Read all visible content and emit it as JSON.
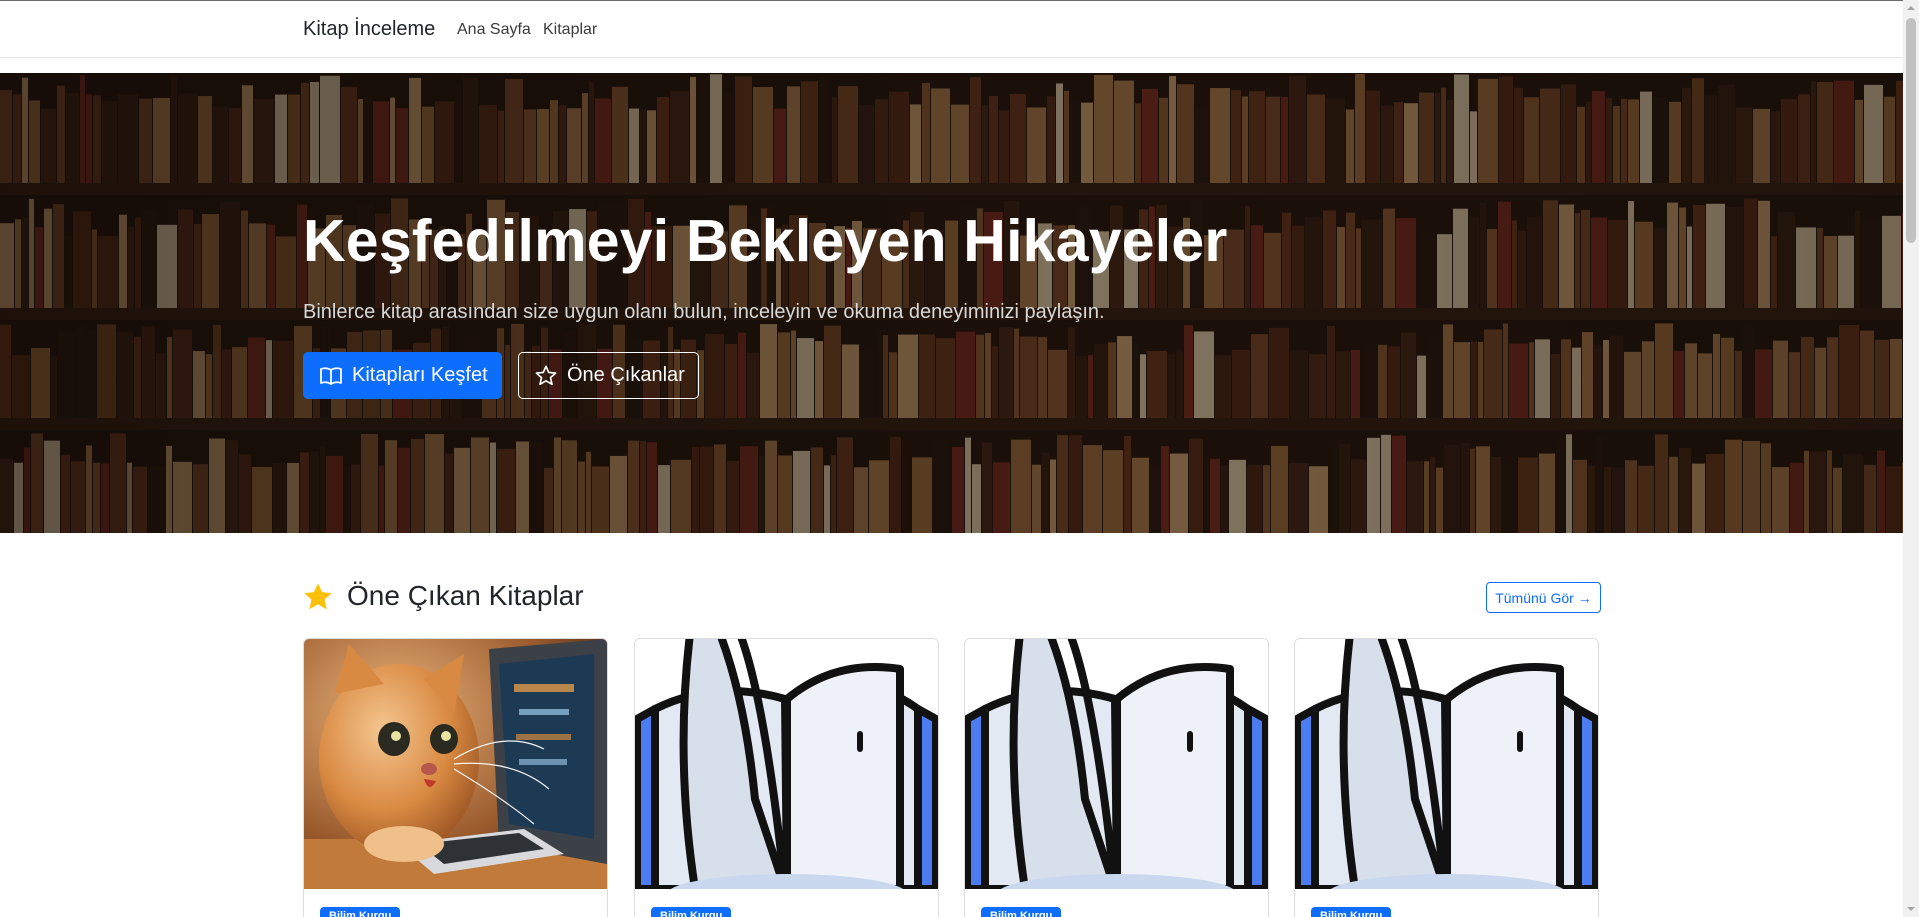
{
  "navbar": {
    "brand": "Kitap İnceleme",
    "links": [
      {
        "label": "Ana Sayfa"
      },
      {
        "label": "Kitaplar"
      }
    ]
  },
  "hero": {
    "title": "Keşfedilmeyi Bekleyen Hikayeler",
    "subtitle": "Binlerce kitap arasından size uygun olanı bulun, inceleyin ve okuma deneyiminizi paylaşın.",
    "primary_button": {
      "label": "Kitapları Keşfet",
      "icon": "book-open-icon"
    },
    "secondary_button": {
      "label": "Öne Çıkanlar",
      "icon": "star-outline-icon"
    }
  },
  "featured": {
    "title": "Öne Çıkan Kitaplar",
    "icon": "star-icon",
    "see_all": "Tümünü Gör",
    "see_all_arrow": "→",
    "cards": [
      {
        "image": "cat-at-computer-image",
        "badge": "Bilim Kurgu"
      },
      {
        "image": "open-book-illustration",
        "badge": "Bilim Kurgu"
      },
      {
        "image": "open-book-illustration",
        "badge": "Bilim Kurgu"
      },
      {
        "image": "open-book-illustration",
        "badge": "Bilim Kurgu"
      }
    ]
  },
  "colors": {
    "primary": "#0d6efd",
    "star": "#ffc107",
    "book_outline": "#111111",
    "book_page": "#e3e9f2",
    "book_spine": "#4b7df0"
  }
}
